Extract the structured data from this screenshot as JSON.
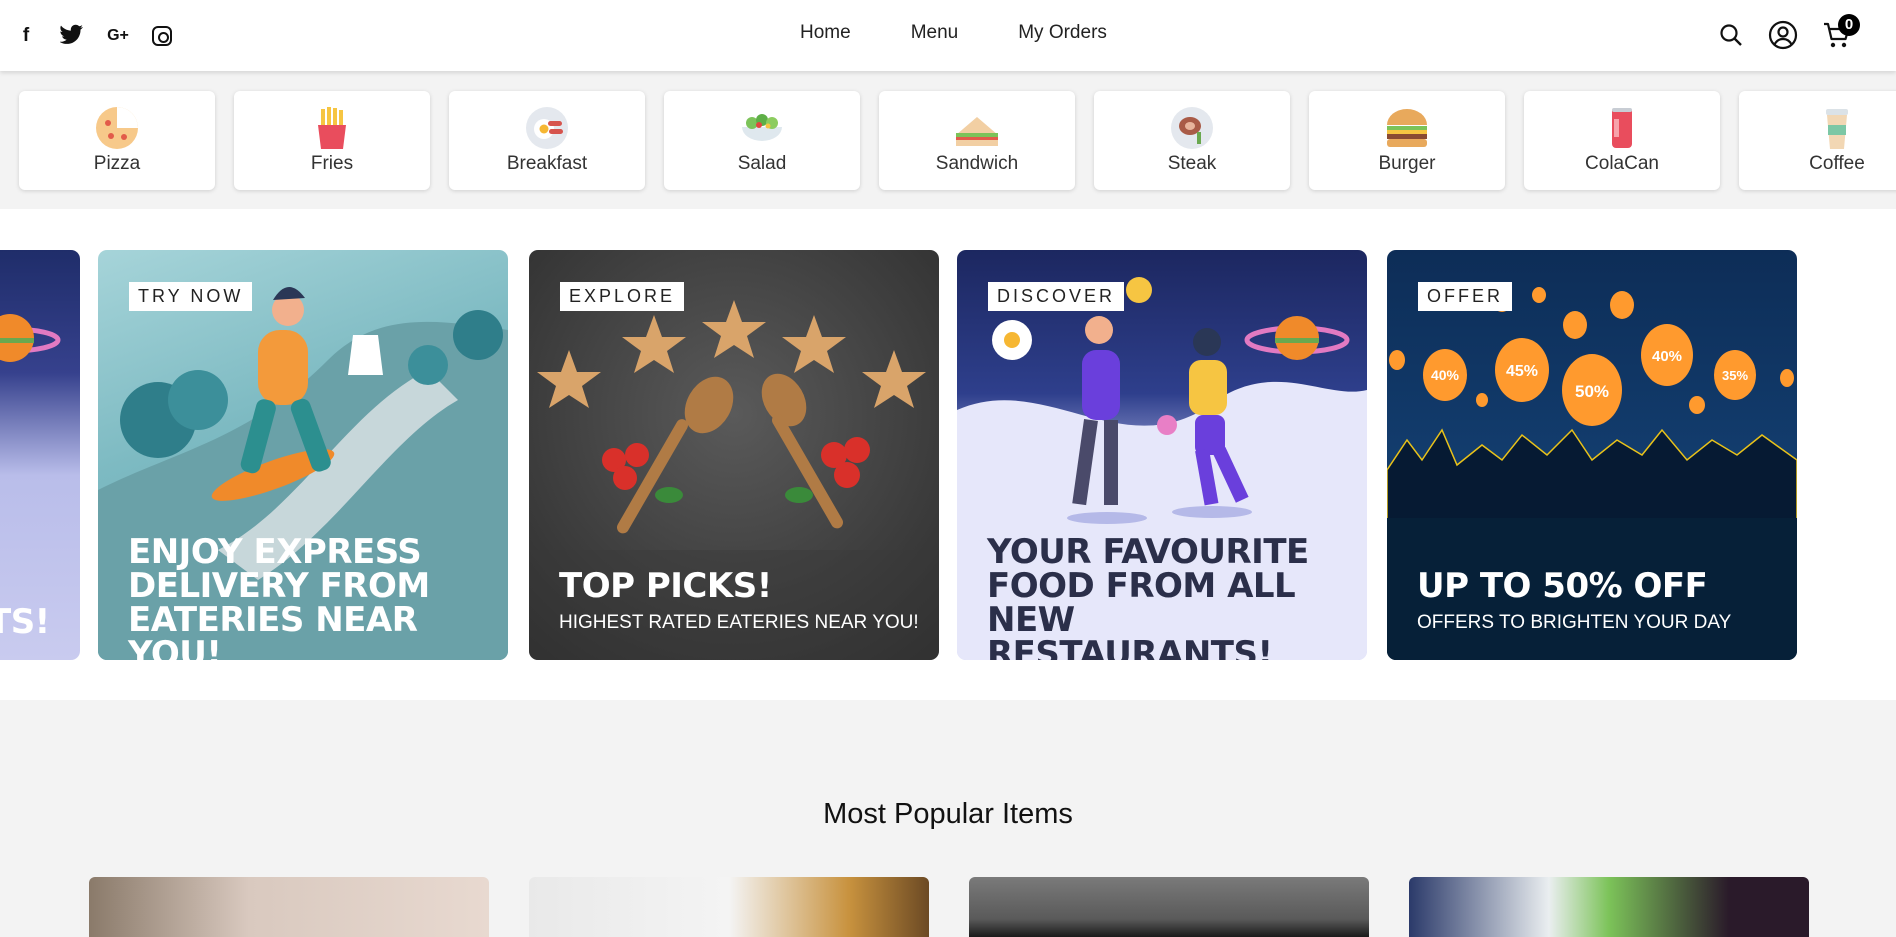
{
  "header": {
    "social": [
      "facebook-icon",
      "twitter-icon",
      "google-plus-icon",
      "instagram-icon"
    ],
    "social_glyphs": {
      "facebook": "f",
      "twitter": "🐦",
      "google": "G+"
    },
    "nav": [
      "Home",
      "Menu",
      "My Orders"
    ],
    "cart_count": "0"
  },
  "categories": [
    {
      "label": "Pizza",
      "icon": "pizza-icon",
      "color": "#f3b06a"
    },
    {
      "label": "Fries",
      "icon": "fries-icon",
      "color": "#f05a5a"
    },
    {
      "label": "Breakfast",
      "icon": "breakfast-icon",
      "color": "#dfe3ea"
    },
    {
      "label": "Salad",
      "icon": "salad-icon",
      "color": "#8cc56d"
    },
    {
      "label": "Sandwich",
      "icon": "sandwich-icon",
      "color": "#e9b98a"
    },
    {
      "label": "Steak",
      "icon": "steak-icon",
      "color": "#c98471"
    },
    {
      "label": "Burger",
      "icon": "burger-icon",
      "color": "#e0a15a"
    },
    {
      "label": "ColaCan",
      "icon": "cola-can-icon",
      "color": "#e94d5d"
    },
    {
      "label": "Coffee",
      "icon": "coffee-icon",
      "color": "#7cc7a5"
    }
  ],
  "banners": [
    {
      "tag": "",
      "line1": "",
      "line2": "",
      "line3": "TS!",
      "sub": ""
    },
    {
      "tag": "TRY NOW",
      "line1": "ENJOY EXPRESS",
      "line2": "DELIVERY FROM",
      "line3": "EATERIES NEAR YOU!",
      "sub": ""
    },
    {
      "tag": "EXPLORE",
      "line1": "",
      "line2": "",
      "line3": "TOP PICKS!",
      "sub": "HIGHEST RATED EATERIES NEAR YOU!"
    },
    {
      "tag": "DISCOVER",
      "line1": "YOUR FAVOURITE",
      "line2": "FOOD FROM ALL",
      "line3": "NEW RESTAURANTS!",
      "sub": ""
    },
    {
      "tag": "OFFER",
      "line1": "",
      "line2": "",
      "line3": "UP TO 50% OFF",
      "sub": "OFFERS TO BRIGHTEN YOUR DAY"
    }
  ],
  "offer_percents": [
    "40%",
    "45%",
    "50%",
    "40%",
    "35%"
  ],
  "section_title": "Most Popular Items"
}
